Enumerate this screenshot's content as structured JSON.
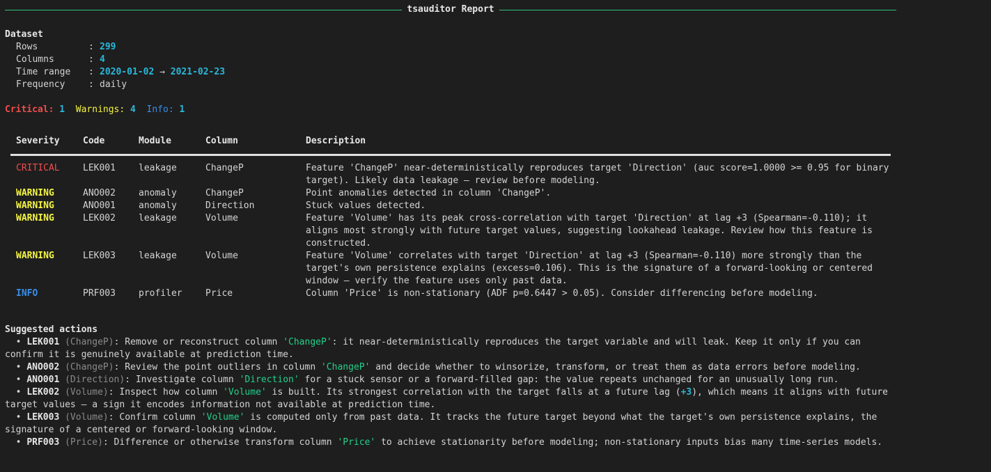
{
  "report_title": "tsauditor Report",
  "dataset": {
    "heading": "Dataset",
    "rows_label": "Rows",
    "rows_value": "299",
    "columns_label": "Columns",
    "columns_value": "4",
    "time_range_label": "Time range",
    "time_start": "2020-01-02",
    "time_arrow": "→",
    "time_end": "2021-02-23",
    "frequency_label": "Frequency",
    "frequency_value": "daily",
    "separator": ":"
  },
  "summary": {
    "critical_label": "Critical",
    "critical_count": "1",
    "warnings_label": "Warnings",
    "warnings_count": "4",
    "info_label": "Info",
    "info_count": "1"
  },
  "table": {
    "headers": [
      "Severity",
      "Code",
      "Module",
      "Column",
      "Description"
    ],
    "rows": [
      {
        "severity": "CRITICAL",
        "severity_color": "#f14c4c",
        "code": "LEK001",
        "module": "leakage",
        "column": "ChangeP",
        "description": "Feature 'ChangeP' near-deterministically reproduces target 'Direction' (auc score=1.0000 >= 0.95 for binary target). Likely data leakage — review before modeling."
      },
      {
        "severity": "WARNING",
        "severity_color": "#f5f543",
        "code": "ANO002",
        "module": "anomaly",
        "column": "ChangeP",
        "description": "Point anomalies detected in column 'ChangeP'."
      },
      {
        "severity": "WARNING",
        "severity_color": "#f5f543",
        "code": "ANO001",
        "module": "anomaly",
        "column": "Direction",
        "description": "Stuck values detected."
      },
      {
        "severity": "WARNING",
        "severity_color": "#f5f543",
        "code": "LEK002",
        "module": "leakage",
        "column": "Volume",
        "description": "Feature 'Volume' has its peak cross-correlation with target 'Direction' at lag +3 (Spearman=-0.110); it aligns most strongly with future target values, suggesting lookahead leakage. Review how this feature is constructed."
      },
      {
        "severity": "WARNING",
        "severity_color": "#f5f543",
        "code": "LEK003",
        "module": "leakage",
        "column": "Volume",
        "description": "Feature 'Volume' correlates with target 'Direction' at lag +3 (Spearman=-0.110) more strongly than the target's own persistence explains (excess=0.106). This is the signature of a forward-looking or centered window — verify the feature uses only past data."
      },
      {
        "severity": "INFO",
        "severity_color": "#3b8eea",
        "code": "PRF003",
        "module": "profiler",
        "column": "Price",
        "description": "Column 'Price' is non-stationary (ADF p=0.6447 > 0.05). Consider differencing before modeling."
      }
    ]
  },
  "actions": {
    "heading": "Suggested actions",
    "bullet": "•",
    "items": [
      {
        "code": "LEK001",
        "column": "(ChangeP)",
        "text_before": ": Remove or reconstruct column ",
        "quoted": "'ChangeP'",
        "text_after": ": it near-deterministically reproduces the target variable and will leak. Keep it only if you can confirm it is genuinely available at prediction time."
      },
      {
        "code": "ANO002",
        "column": "(ChangeP)",
        "text_before": ": Review the point outliers in column ",
        "quoted": "'ChangeP'",
        "text_after": " and decide whether to winsorize, transform, or treat them as data errors before modeling."
      },
      {
        "code": "ANO001",
        "column": "(Direction)",
        "text_before": ": Investigate column ",
        "quoted": "'Direction'",
        "text_after": " for a stuck sensor or a forward-filled gap: the value repeats unchanged for an unusually long run."
      },
      {
        "code": "LEK002",
        "column": "(Volume)",
        "text_before": ": Inspect how column ",
        "quoted": "'Volume'",
        "text_after": " is built. Its strongest correlation with the target falls at a future lag (",
        "highlight": "+3",
        "text_end": "), which means it aligns with future target values — a sign it encodes information not available at prediction time."
      },
      {
        "code": "LEK003",
        "column": "(Volume)",
        "text_before": ": Confirm column ",
        "quoted": "'Volume'",
        "text_after": " is computed only from past data. It tracks the future target beyond what the target's own persistence explains, the signature of a centered or forward-looking window."
      },
      {
        "code": "PRF003",
        "column": "(Price)",
        "text_before": ": Difference or otherwise transform column ",
        "quoted": "'Price'",
        "text_after": " to achieve stationarity before modeling; non-stationary inputs bias many time-series models."
      }
    ]
  }
}
